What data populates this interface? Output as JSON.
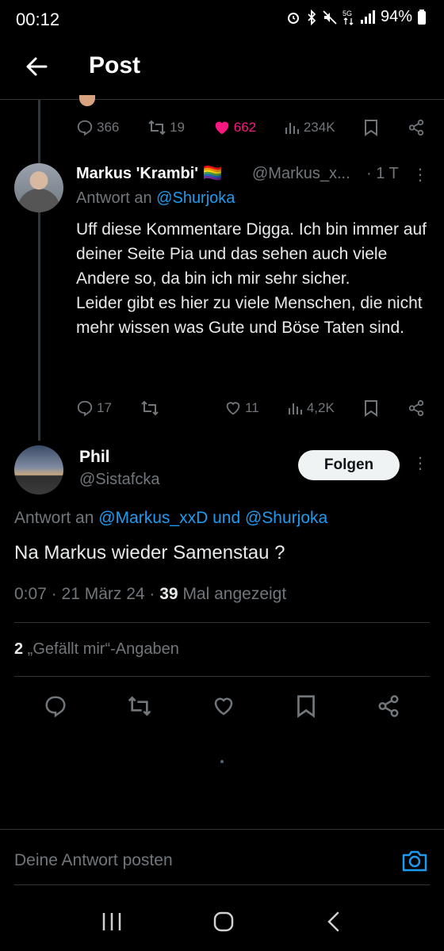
{
  "status": {
    "time": "00:12",
    "battery": "94%"
  },
  "header": {
    "title": "Post"
  },
  "top_reply_actions": {
    "replies": "366",
    "reposts": "19",
    "likes": "662",
    "views": "234K"
  },
  "tweet2": {
    "name": "Markus 'Krambi' 🏳️‍🌈",
    "handle": "@Markus_x...",
    "time": "· 1 T",
    "reply_prefix": "Antwort an",
    "reply_mention": "@Shurjoka",
    "text": "Uff diese Kommentare Digga. Ich bin immer auf deiner Seite Pia und das sehen auch viele Andere so, da bin ich mir sehr sicher.\nLeider gibt es hier zu viele Menschen, die nicht mehr wissen was Gute und Böse Taten sind.",
    "replies": "17",
    "reposts": "",
    "likes": "11",
    "views": "4,2K"
  },
  "tweet3": {
    "name": "Phil",
    "handle": "@Sistafcka",
    "follow_label": "Folgen",
    "reply_prefix": "Antwort an",
    "reply_mention1": "@Markus_xxD",
    "reply_and": "und",
    "reply_mention2": "@Shurjoka",
    "text": "Na Markus wieder Samenstau ?",
    "meta_time": "0:07 · 21 März 24 · ",
    "meta_views": "39",
    "meta_views_label": " Mal angezeigt",
    "likes_count": "2",
    "likes_label": " „Gefällt mir“-Angaben"
  },
  "composer": {
    "placeholder": "Deine Antwort posten"
  },
  "colors": {
    "accent": "#1d9bf0",
    "like": "#f91880",
    "muted": "#71767b"
  }
}
